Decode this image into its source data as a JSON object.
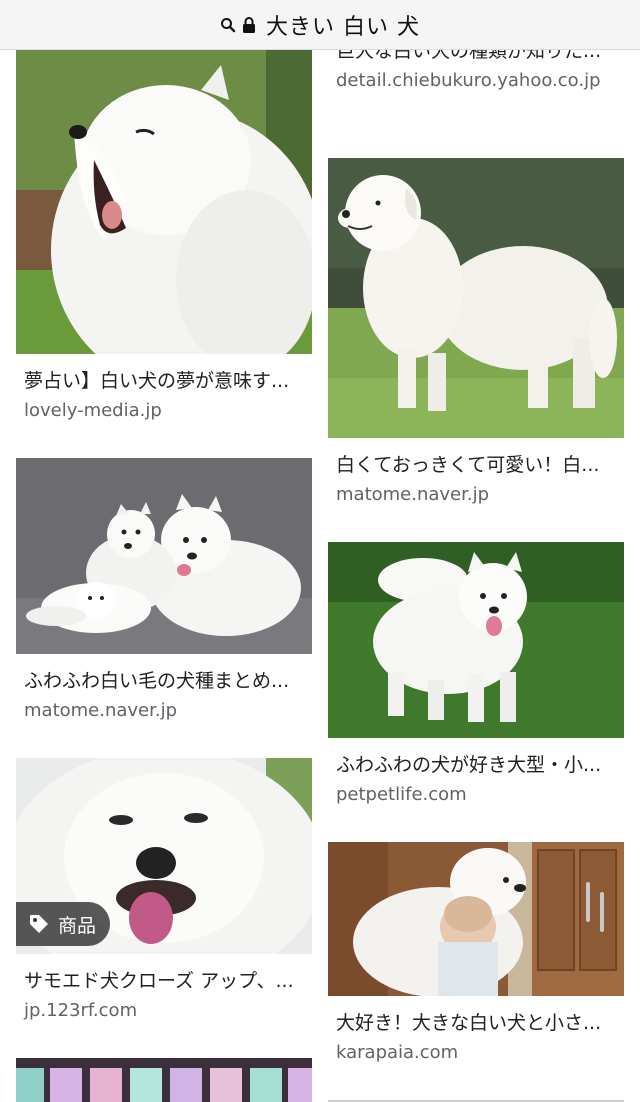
{
  "search": {
    "query": "大きい 白い 犬"
  },
  "results": {
    "left": [
      {
        "title": "夢占い】白い犬の夢が意味す...",
        "domain": "lovely-media.jp",
        "image_icon": "yawning-samoyed-image"
      },
      {
        "title": "ふわふわ白い毛の犬種まとめ...",
        "domain": "matome.naver.jp",
        "image_icon": "samoyed-family-image"
      },
      {
        "title": "サモエド犬クローズ アップ、...",
        "domain": "jp.123rf.com",
        "image_icon": "samoyed-closeup-image",
        "badge": "商品"
      }
    ],
    "right": [
      {
        "title": "巨大な白い犬の種類が知りた...",
        "domain": "detail.chiebukuro.yahoo.co.jp"
      },
      {
        "title": "白くておっきくて可愛い！白...",
        "domain": "matome.naver.jp",
        "image_icon": "great-pyrenees-image"
      },
      {
        "title": "ふわふわの犬が好き大型・小...",
        "domain": "petpetlife.com",
        "image_icon": "samoyed-standing-image"
      },
      {
        "title": "大好き！大きな白い犬と小さ...",
        "domain": "karapaia.com",
        "image_icon": "dog-and-child-image"
      }
    ]
  }
}
